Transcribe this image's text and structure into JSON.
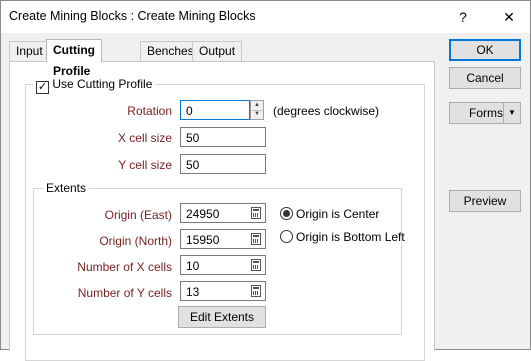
{
  "window": {
    "title": "Create Mining Blocks : Create Mining Blocks",
    "help_label": "?",
    "close_label": "✕"
  },
  "tabs": [
    {
      "label": "Input",
      "active": false
    },
    {
      "label": "Cutting Profile",
      "active": true
    },
    {
      "label": "Benches",
      "active": false
    },
    {
      "label": "Output",
      "active": false
    }
  ],
  "cutting_profile": {
    "use_label": "Use Cutting Profile",
    "use_checked": true,
    "rotation_label": "Rotation",
    "rotation_value": "0",
    "rotation_unit": "(degrees clockwise)",
    "xcell_label": "X cell size",
    "xcell_value": "50",
    "ycell_label": "Y cell size",
    "ycell_value": "50"
  },
  "extents": {
    "legend": "Extents",
    "origin_east_label": "Origin (East)",
    "origin_east_value": "24950",
    "origin_north_label": "Origin (North)",
    "origin_north_value": "15950",
    "num_x_label": "Number of X cells",
    "num_x_value": "10",
    "num_y_label": "Number of Y cells",
    "num_y_value": "13",
    "origin_center_label": "Origin is Center",
    "origin_bottom_left_label": "Origin is Bottom Left",
    "selected_origin": "center",
    "edit_button": "Edit Extents"
  },
  "buttons": {
    "ok": "OK",
    "cancel": "Cancel",
    "forms": "Forms",
    "forms_arrow": "▼",
    "preview": "Preview"
  },
  "colors": {
    "label_red": "#7a1f1f",
    "focus_blue": "#0078d7"
  }
}
